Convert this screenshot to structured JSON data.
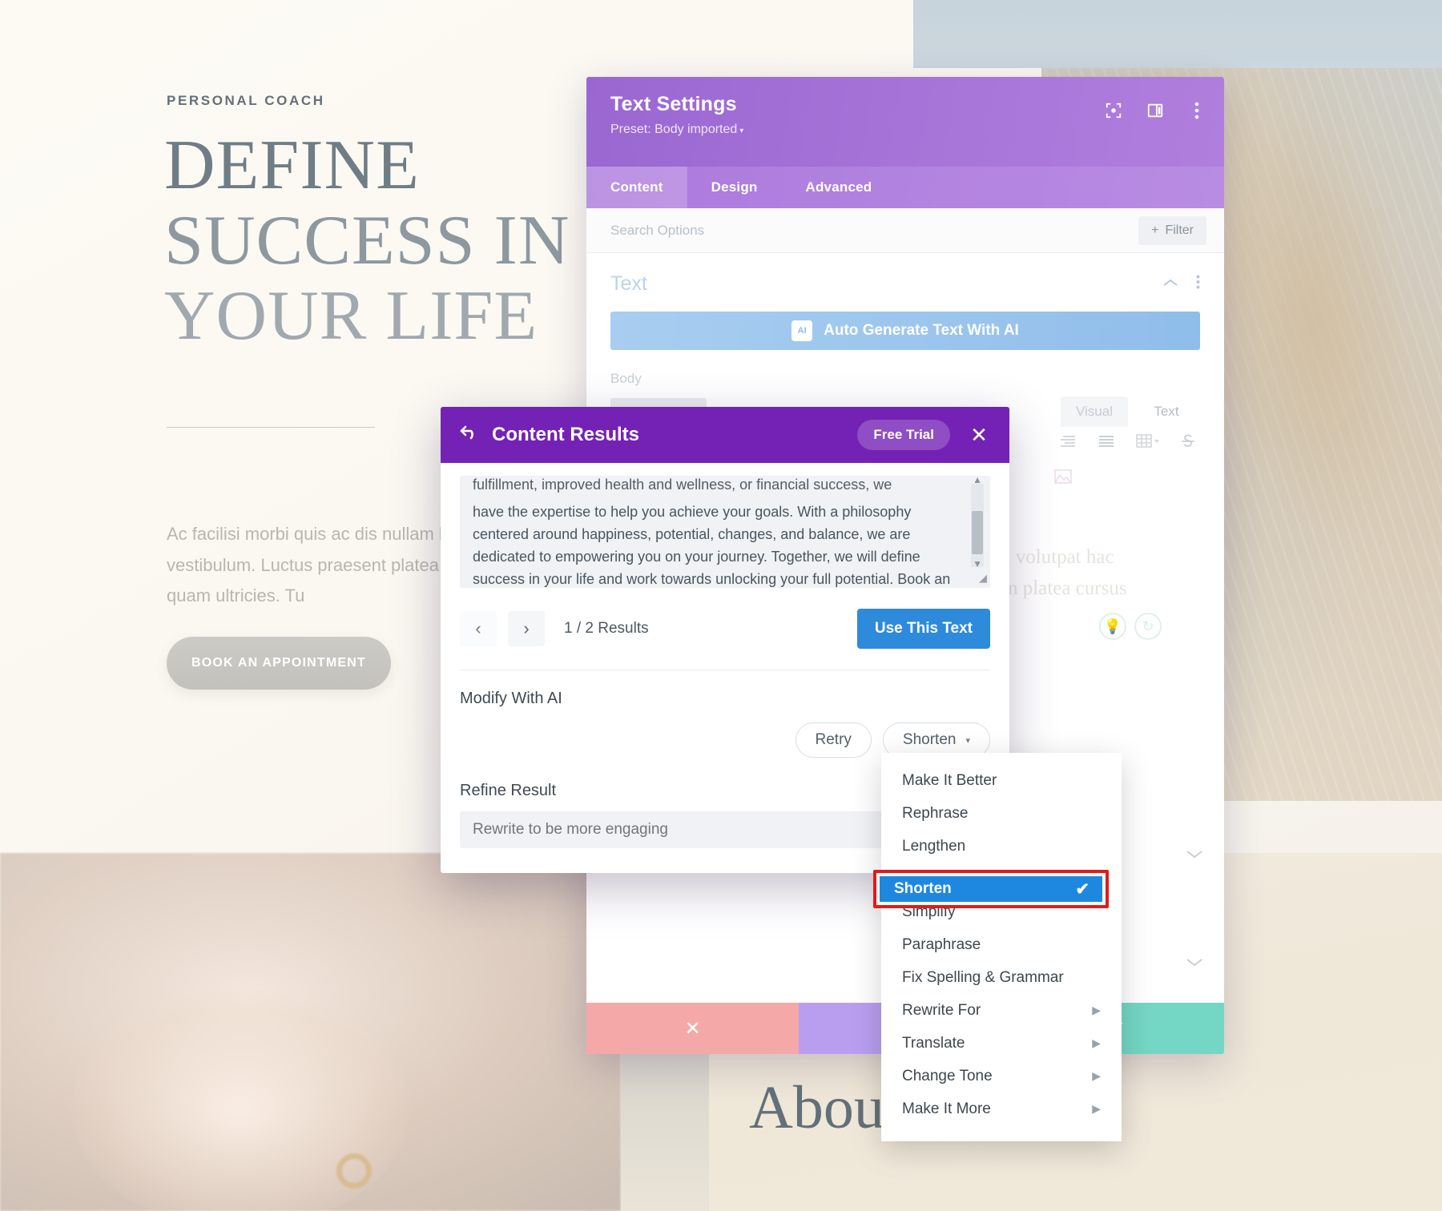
{
  "website": {
    "eyebrow": "PERSONAL COACH",
    "title_line1": "DEFINE",
    "title_line2": "SUCCESS IN",
    "title_line3": "YOUR LIFE",
    "body": "Ac facilisi morbi quis ac dis nullam hac vestibulum. Luctus praesent platea cursus quam ultricies. Tu",
    "cta_label": "BOOK AN APPOINTMENT",
    "about_heading": "About          radly",
    "ghost_text": "nda a volutpat hac\nmpien platea cursus"
  },
  "text_settings": {
    "title": "Text Settings",
    "preset": "Preset: Body imported",
    "preset_caret": "▾",
    "header_icons": [
      "fullscreen-icon",
      "layout-icon",
      "more-vertical-icon"
    ],
    "tabs": [
      {
        "label": "Content",
        "active": true
      },
      {
        "label": "Design",
        "active": false
      },
      {
        "label": "Advanced",
        "active": false
      }
    ],
    "search_placeholder": "Search Options",
    "filter_label": "Filter",
    "filter_plus": "+",
    "section_title": "Text",
    "ai_button_label": "Auto Generate Text With AI",
    "ai_badge": "AI",
    "field_label": "Body",
    "editor_tabs": [
      {
        "label": "Visual",
        "active": false
      },
      {
        "label": "Text",
        "active": true
      }
    ],
    "footer_buttons": [
      {
        "name": "delete",
        "glyph": "✕",
        "color": "#f5a8a8"
      },
      {
        "name": "undo",
        "glyph": "↺",
        "color": "#b99ef0"
      },
      {
        "name": "save",
        "glyph": "✓",
        "color": "#74d6c4"
      }
    ]
  },
  "content_results": {
    "back_glyph": "↰",
    "title": "Content Results",
    "free_trial_label": "Free Trial",
    "close_glyph": "✕",
    "result_text_cut": "fulfillment, improved health and wellness, or financial success, we",
    "result_text": "have the expertise to help you achieve your goals. With a philosophy centered around happiness, potential, changes, and balance, we are dedicated to empowering you on your journey. Together, we will define success in your life and work towards unlocking your full potential. Book an appointment today and let's grow together!",
    "prev_glyph": "‹",
    "next_glyph": "›",
    "count_label": "1 / 2 Results",
    "use_button": "Use This Text",
    "modify_label": "Modify With AI",
    "retry_button": "Retry",
    "shorten_button": "Shorten",
    "shorten_caret": "▾",
    "refine_label": "Refine Result",
    "refine_placeholder": "Rewrite to be more engaging"
  },
  "dropdown": {
    "items": [
      {
        "label": "Make It Better",
        "submenu": false,
        "selected": false
      },
      {
        "label": "Rephrase",
        "submenu": false,
        "selected": false
      },
      {
        "label": "Lengthen",
        "submenu": false,
        "selected": false
      },
      {
        "label": "Shorten",
        "submenu": false,
        "selected": true
      },
      {
        "label": "Simplify",
        "submenu": false,
        "selected": false
      },
      {
        "label": "Paraphrase",
        "submenu": false,
        "selected": false
      },
      {
        "label": "Fix Spelling & Grammar",
        "submenu": false,
        "selected": false
      },
      {
        "label": "Rewrite For",
        "submenu": true,
        "selected": false
      },
      {
        "label": "Translate",
        "submenu": true,
        "selected": false
      },
      {
        "label": "Change Tone",
        "submenu": true,
        "selected": false
      },
      {
        "label": "Make It More",
        "submenu": true,
        "selected": false
      }
    ],
    "submenu_arrow": "▶",
    "check_glyph": "✔",
    "highlight_color": "#1e88e0",
    "highlight_border_color": "#e01b1b"
  },
  "colors": {
    "modal_purple": "#a673d8",
    "dialog_purple": "#7422b5",
    "primary_blue": "#2e8ada",
    "teal": "#74d6c4",
    "red_box": "#e01b1b"
  }
}
